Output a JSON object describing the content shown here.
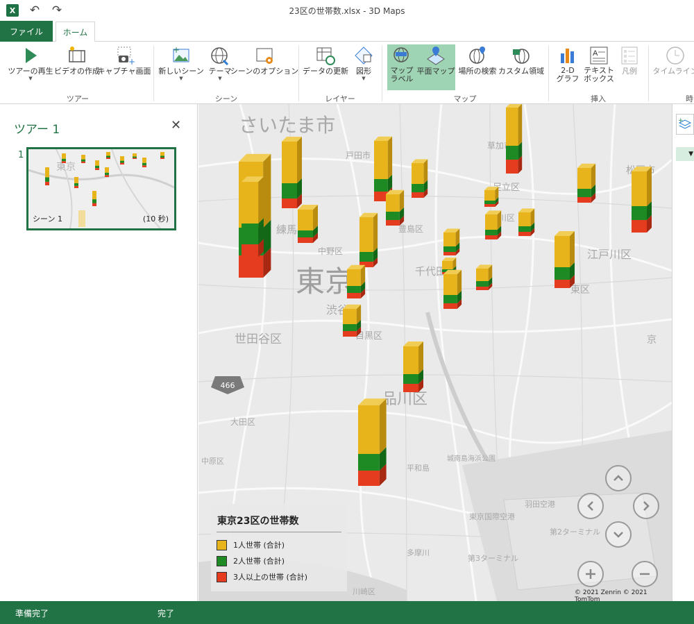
{
  "titlebar": {
    "logo": "X",
    "title": "23区の世帯数.xlsx - 3D Maps",
    "undo_icon": "undo-icon",
    "redo_icon": "redo-icon"
  },
  "tabs": {
    "file": "ファイル",
    "home": "ホーム"
  },
  "ribbon": {
    "buttons": [
      {
        "label": "ツアーの再生",
        "icon": "play-icon"
      },
      {
        "label": "ビデオの作成",
        "icon": "film-icon"
      },
      {
        "label": "キャプチャ画面",
        "icon": "camera-icon"
      },
      {
        "label": "新しいシーン",
        "icon": "new-scene-icon"
      },
      {
        "label": "テーマ",
        "icon": "globe-theme-icon"
      },
      {
        "label": "シーンのオプション",
        "icon": "scene-options-icon"
      },
      {
        "label": "データの更新",
        "icon": "refresh-data-icon"
      },
      {
        "label": "図形",
        "icon": "shapes-icon"
      },
      {
        "label": "マップ\nラベル",
        "icon": "map-labels-icon"
      },
      {
        "label": "平面マップ",
        "icon": "flat-map-icon"
      },
      {
        "label": "場所の検索",
        "icon": "find-location-icon"
      },
      {
        "label": "カスタム領域",
        "icon": "custom-regions-icon"
      },
      {
        "label": "2-D\nグラフ",
        "icon": "bar-chart-icon"
      },
      {
        "label": "テキスト\nボックス",
        "icon": "text-box-icon"
      },
      {
        "label": "凡例",
        "icon": "legend-icon"
      },
      {
        "label": "タイムライン",
        "icon": "timeline-icon"
      }
    ],
    "groups": [
      "ツアー",
      "シーン",
      "レイヤー",
      "マップ",
      "挿入",
      "時"
    ]
  },
  "tour_panel": {
    "title": "ツアー 1",
    "scene_number": "1",
    "scene_label": "シーン 1",
    "scene_duration": "(10 秒)"
  },
  "map": {
    "labels": [
      "さいたま市",
      "戸田市",
      "足立区",
      "草加市",
      "練馬区",
      "中野区",
      "東京",
      "千代田区",
      "渋谷区",
      "目黒区",
      "世田谷区",
      "品川区",
      "江戸川区",
      "松戸市",
      "荒川区",
      "豊島区",
      "東区",
      "京",
      "466",
      "大田区",
      "平和島",
      "東京国際空港",
      "第2ターミナル",
      "第3ターミナル",
      "多摩川",
      "川崎区",
      "羽田空港",
      "中原区",
      "城南島海浜公園"
    ],
    "copyright": "© 2021 Zenrin  © 2021 TomTom"
  },
  "legend": {
    "title": "東京23区の世帯数",
    "items": [
      {
        "label": "1人世帯 (合計)",
        "color": "#e8b41c"
      },
      {
        "label": "2人世帯 (合計)",
        "color": "#1e8a23"
      },
      {
        "label": "3人以上の世帯 (合計)",
        "color": "#e53b1f"
      }
    ]
  },
  "nav": {
    "up": "chevron-up-icon",
    "left": "chevron-left-icon",
    "right": "chevron-right-icon",
    "down": "chevron-down-icon",
    "zoom_in": "plus-icon",
    "zoom_out": "minus-icon"
  },
  "status": {
    "left": "準備完了",
    "mid": "完了"
  }
}
